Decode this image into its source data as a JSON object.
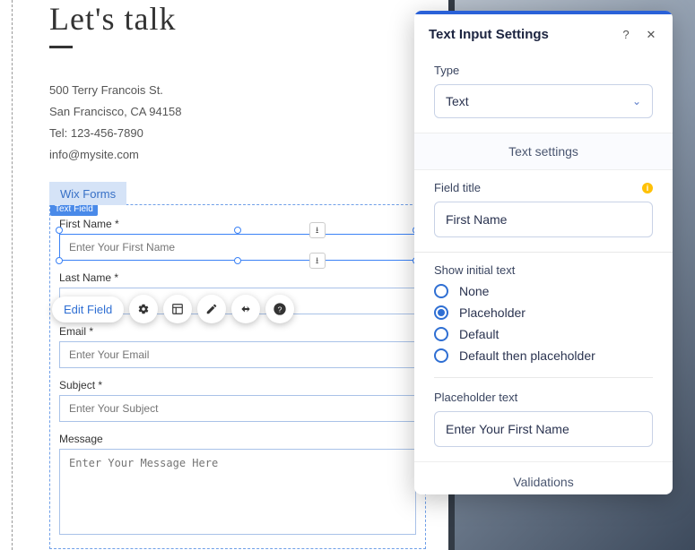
{
  "page": {
    "title": "Let's talk",
    "contact": {
      "line1": "500 Terry Francois St.",
      "line2": "San Francisco, CA 94158",
      "line3": "Tel: 123-456-7890",
      "line4": "info@mysite.com"
    },
    "wix_forms_label": "Wix Forms",
    "text_field_tag": "Text Field"
  },
  "form": {
    "fields": [
      {
        "label": "First Name *",
        "placeholder": "Enter Your First Name"
      },
      {
        "label": "Last Name *",
        "placeholder": ""
      },
      {
        "label": "Email *",
        "placeholder": "Enter Your Email"
      },
      {
        "label": "Subject *",
        "placeholder": "Enter Your Subject"
      },
      {
        "label": "Message",
        "placeholder": "Enter Your Message Here"
      }
    ]
  },
  "toolbar": {
    "edit_field": "Edit Field"
  },
  "settings": {
    "title": "Text Input Settings",
    "type_label": "Type",
    "type_value": "Text",
    "text_settings_header": "Text settings",
    "field_title_label": "Field title",
    "field_title_value": "First Name",
    "show_initial_label": "Show initial text",
    "radios": {
      "none": "None",
      "placeholder": "Placeholder",
      "default": "Default",
      "default_then": "Default then placeholder"
    },
    "selected_radio": "placeholder",
    "placeholder_text_label": "Placeholder text",
    "placeholder_text_value": "Enter Your First Name",
    "validations": "Validations"
  }
}
